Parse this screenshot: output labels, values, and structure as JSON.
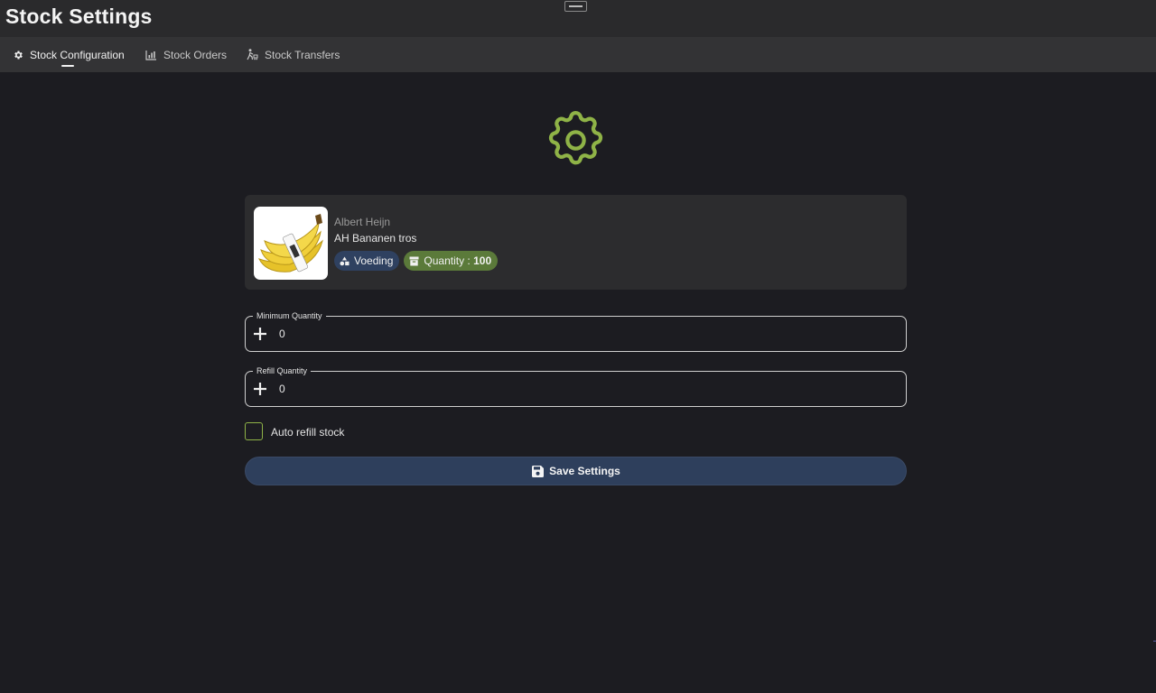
{
  "window": {
    "title": "Stock Settings"
  },
  "tabs": [
    {
      "label": "Stock Configuration",
      "icon": "gear-icon",
      "active": true
    },
    {
      "label": "Stock Orders",
      "icon": "chart-icon",
      "active": false
    },
    {
      "label": "Stock Transfers",
      "icon": "person-cart-icon",
      "active": false
    }
  ],
  "product": {
    "brand": "Albert Heijn",
    "name": "AH Bananen tros",
    "image_icon": "banana-image",
    "category": "Voeding",
    "quantity_label": "Quantity : ",
    "quantity_value": "100"
  },
  "fields": {
    "minimum": {
      "label": "Minimum Quantity",
      "value": "0"
    },
    "refill": {
      "label": "Refill Quantity",
      "value": "0"
    }
  },
  "auto_refill": {
    "label": "Auto refill stock",
    "checked": false
  },
  "save": {
    "label": "Save Settings"
  },
  "colors": {
    "accent_green": "#8fb347",
    "button_blue": "#2e3f5c",
    "quantity_chip": "#5b7a3a",
    "category_chip": "#2f4160"
  }
}
